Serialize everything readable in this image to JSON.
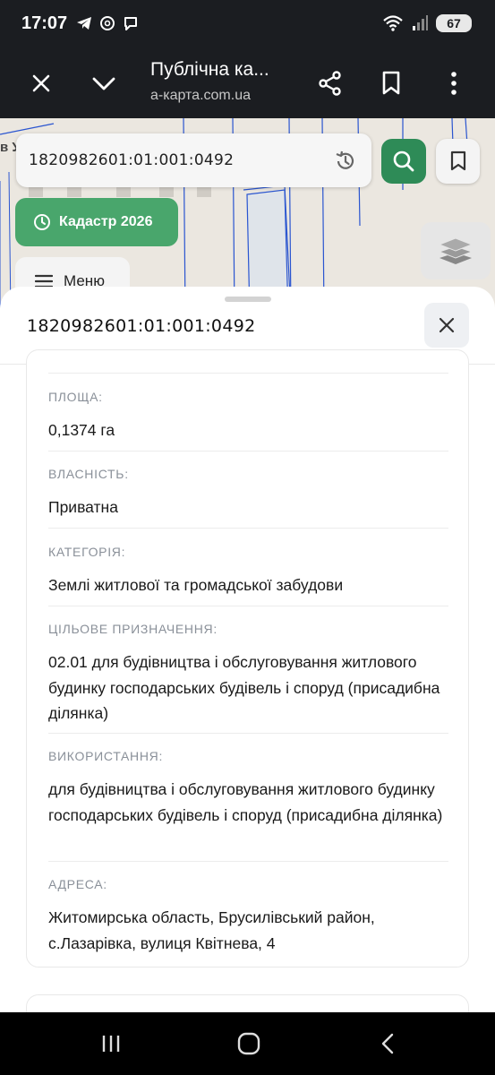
{
  "status_bar": {
    "time": "17:07",
    "battery": "67"
  },
  "browser": {
    "title": "Публічна ка...",
    "url": "а-карта.com.ua"
  },
  "map": {
    "search_value": "1820982601:01:001:0492",
    "kadastr_label": "Кадастр 2026",
    "menu_label": "Меню",
    "street_fragment": "в У"
  },
  "sheet": {
    "title": "1820982601:01:001:0492",
    "fields": [
      {
        "label": "ПЛОЩА:",
        "value": "0,1374 га"
      },
      {
        "label": "ВЛАСНІСТЬ:",
        "value": "Приватна"
      },
      {
        "label": "КАТЕГОРІЯ:",
        "value": "Землі житлової та громадської забудови"
      },
      {
        "label": "ЦІЛЬОВЕ ПРИЗНАЧЕННЯ:",
        "value": "02.01 для будівництва і обслуговування житлового будинку господарських будівель і споруд (присадибна ділянка)"
      },
      {
        "label": "ВИКОРИСТАННЯ:",
        "value": "для будівництва і обслуговування житлового будинку господарських будівель і споруд (присадибна ділянка)"
      },
      {
        "label": "АДРЕСА:",
        "value": "Житомирська область, Брусилівський район, с.Лазарівка, вулиця Квітнева, 4"
      }
    ]
  },
  "colors": {
    "accent_green": "#2e8b57",
    "kadastr_green": "#49a66c",
    "map_line_blue": "#2a55d0"
  },
  "icons": [
    "wifi-icon",
    "signal-icon",
    "telegram-icon",
    "threads-icon",
    "viber-icon",
    "close-icon",
    "chevron-down-icon",
    "share-icon",
    "bookmark-icon",
    "more-icon",
    "history-icon",
    "search-icon",
    "clock-icon",
    "layers-icon",
    "menu-icon",
    "recents-icon",
    "home-icon",
    "back-icon"
  ]
}
